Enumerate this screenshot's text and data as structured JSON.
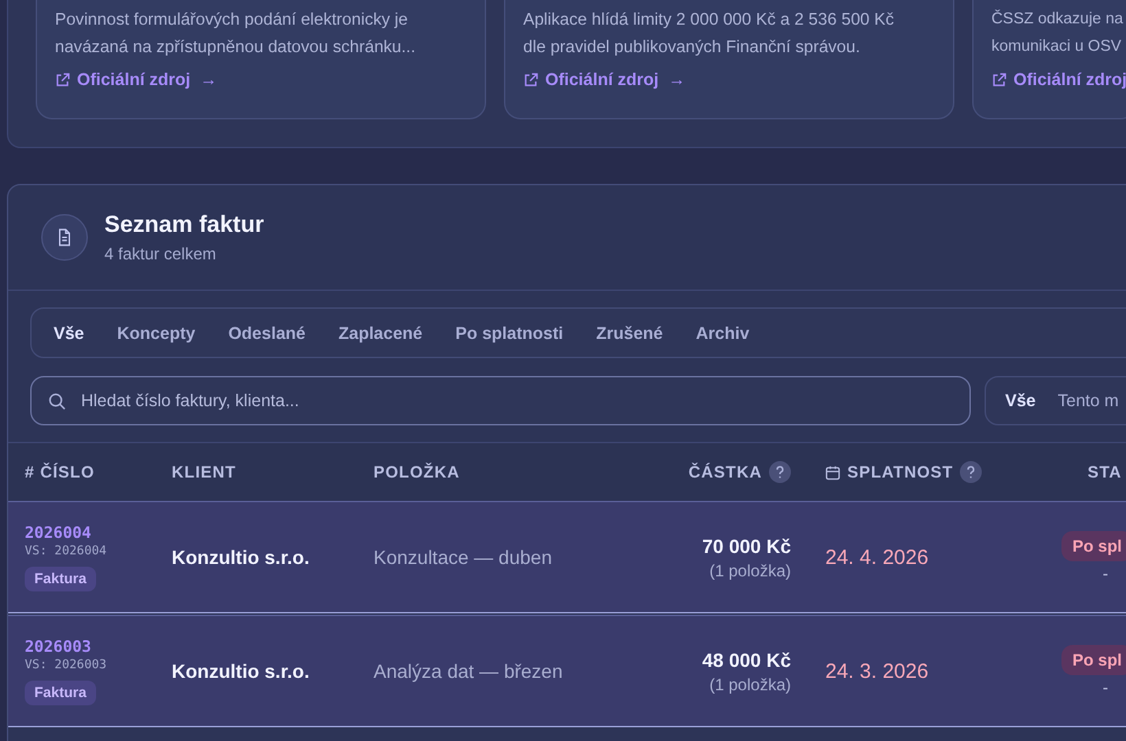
{
  "source_cards": [
    {
      "text": "Povinnost formulářových podání elektronicky je navázaná na zpřístupněnou datovou schránku...",
      "link": "Oficiální zdroj",
      "arrow": "→"
    },
    {
      "text": "Aplikace hlídá limity 2 000 000 Kč a 2 536 500 Kč dle pravidel publikovaných Finanční správou.",
      "link": "Oficiální zdroj",
      "arrow": "→"
    },
    {
      "text": "ČSSZ odkazuje na komunikaci u OSV",
      "link": "Oficiální zdroj"
    }
  ],
  "invoices": {
    "title": "Seznam faktur",
    "subtitle": "4 faktur celkem",
    "tabs": [
      {
        "label": "Vše",
        "selected": true
      },
      {
        "label": "Koncepty",
        "selected": false
      },
      {
        "label": "Odeslané",
        "selected": false
      },
      {
        "label": "Zaplacené",
        "selected": false
      },
      {
        "label": "Po splatnosti",
        "selected": false
      },
      {
        "label": "Zrušené",
        "selected": false
      },
      {
        "label": "Archiv",
        "selected": false
      }
    ],
    "search": {
      "placeholder": "Hledat číslo faktury, klienta..."
    },
    "period_filter": [
      {
        "label": "Vše",
        "selected": true
      },
      {
        "label": "Tento m",
        "selected": false
      }
    ],
    "table": {
      "columns": [
        {
          "label": "# ČÍSLO",
          "kind": "plain"
        },
        {
          "label": "KLIENT",
          "kind": "plain"
        },
        {
          "label": "POLOŽKA",
          "kind": "plain"
        },
        {
          "label": "ČÁSTKA",
          "kind": "help"
        },
        {
          "label": "SPLATNOST",
          "kind": "date-help"
        },
        {
          "label": "STA",
          "kind": "plain"
        }
      ],
      "rows": [
        {
          "number": "2026004",
          "vs": "VS: 2026004",
          "type": "Faktura",
          "client": "Konzultio s.r.o.",
          "item": "Konzultace — duben",
          "amount": "70 000 Kč",
          "count": "(1 položka)",
          "due": "24. 4. 2026",
          "overdue": true,
          "status": "Po spl",
          "note": "-"
        },
        {
          "number": "2026003",
          "vs": "VS: 2026003",
          "type": "Faktura",
          "client": "Konzultio s.r.o.",
          "item": "Analýza dat — březen",
          "amount": "48 000 Kč",
          "count": "(1 položka)",
          "due": "24. 3. 2026",
          "overdue": true,
          "status": "Po spl",
          "note": "-"
        }
      ]
    }
  }
}
